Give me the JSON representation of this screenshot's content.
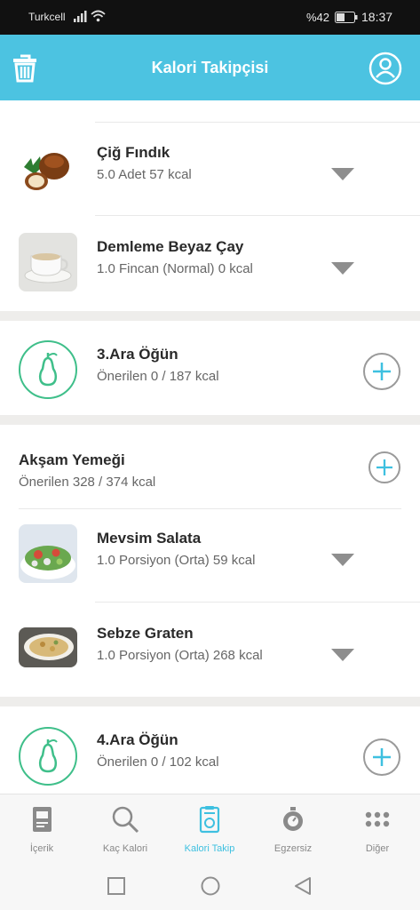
{
  "status_bar": {
    "carrier": "Turkcell",
    "battery_percent": "%42",
    "time": "18:37"
  },
  "header": {
    "title": "Kalori Takipçisi"
  },
  "entries_top": [
    {
      "name": "Çiğ Fındık",
      "detail": "5.0 Adet 57 kcal"
    },
    {
      "name": "Demleme Beyaz Çay",
      "detail": "1.0 Fincan (Normal) 0 kcal"
    }
  ],
  "snack3": {
    "title": "3.Ara Öğün",
    "subtitle": "Önerilen 0 / 187 kcal"
  },
  "dinner": {
    "title": "Akşam Yemeği",
    "subtitle": "Önerilen 328 / 374 kcal",
    "items": [
      {
        "name": "Mevsim Salata",
        "detail": "1.0 Porsiyon (Orta) 59 kcal"
      },
      {
        "name": "Sebze Graten",
        "detail": "1.0 Porsiyon (Orta) 268 kcal"
      }
    ]
  },
  "snack4": {
    "title": "4.Ara Öğün",
    "subtitle": "Önerilen 0 / 102 kcal"
  },
  "bottom_nav": [
    {
      "label": "İçerik",
      "icon": "book-icon"
    },
    {
      "label": "Kaç Kalori",
      "icon": "search-icon"
    },
    {
      "label": "Kalori Takip",
      "icon": "tracker-icon",
      "active": true
    },
    {
      "label": "Egzersiz",
      "icon": "stopwatch-icon"
    },
    {
      "label": "Diğer",
      "icon": "more-icon"
    }
  ],
  "colors": {
    "accent": "#4cc3e1",
    "pear_green": "#3fbf8a",
    "nav_active": "#3ec0e0"
  }
}
